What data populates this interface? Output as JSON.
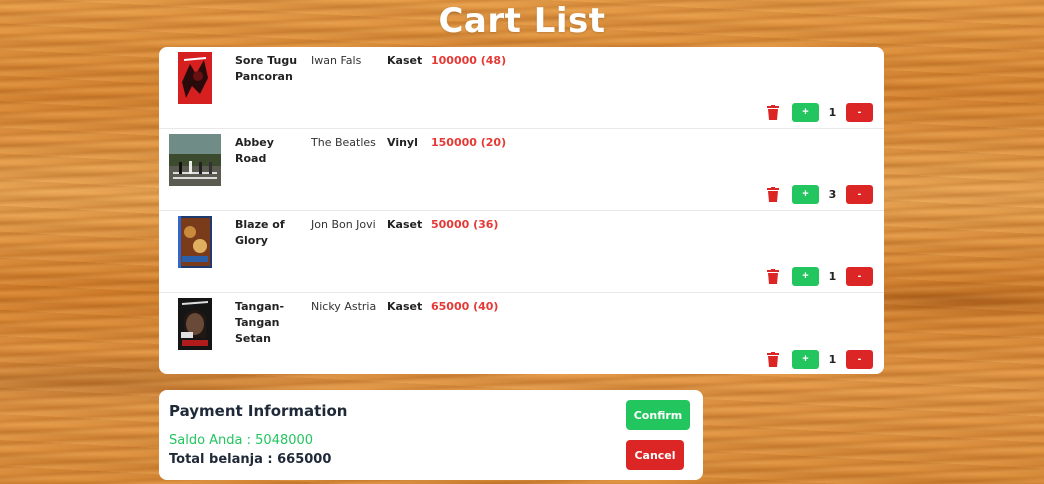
{
  "page": {
    "title": "Cart List"
  },
  "cart": {
    "items": [
      {
        "title": "Sore Tugu Pancoran",
        "artist": "Iwan Fals",
        "format": "Kaset",
        "price": "100000 (48)",
        "qty": "1",
        "plus": "+",
        "minus": "-",
        "cover_icon": "cassette-cover-red"
      },
      {
        "title": "Abbey Road",
        "artist": "The Beatles",
        "format": "Vinyl",
        "price": "150000 (20)",
        "qty": "3",
        "plus": "+",
        "minus": "-",
        "cover_icon": "vinyl-cover-photo"
      },
      {
        "title": "Blaze of Glory",
        "artist": "Jon Bon Jovi",
        "format": "Kaset",
        "price": "50000 (36)",
        "qty": "1",
        "plus": "+",
        "minus": "-",
        "cover_icon": "cassette-cover-blue"
      },
      {
        "title": "Tangan-Tangan Setan",
        "artist": "Nicky Astria",
        "format": "Kaset",
        "price": "65000 (40)",
        "qty": "1",
        "plus": "+",
        "minus": "-",
        "cover_icon": "cassette-cover-portrait"
      }
    ]
  },
  "payment": {
    "title": "Payment Information",
    "saldo": "Saldo Anda : 5048000",
    "total": "Total belanja : 665000",
    "confirm_label": "Confirm",
    "cancel_label": "Cancel"
  },
  "colors": {
    "accent_green": "#22c55e",
    "accent_red": "#dc2626",
    "price_red": "#e53935",
    "wood": "#e0923c"
  }
}
